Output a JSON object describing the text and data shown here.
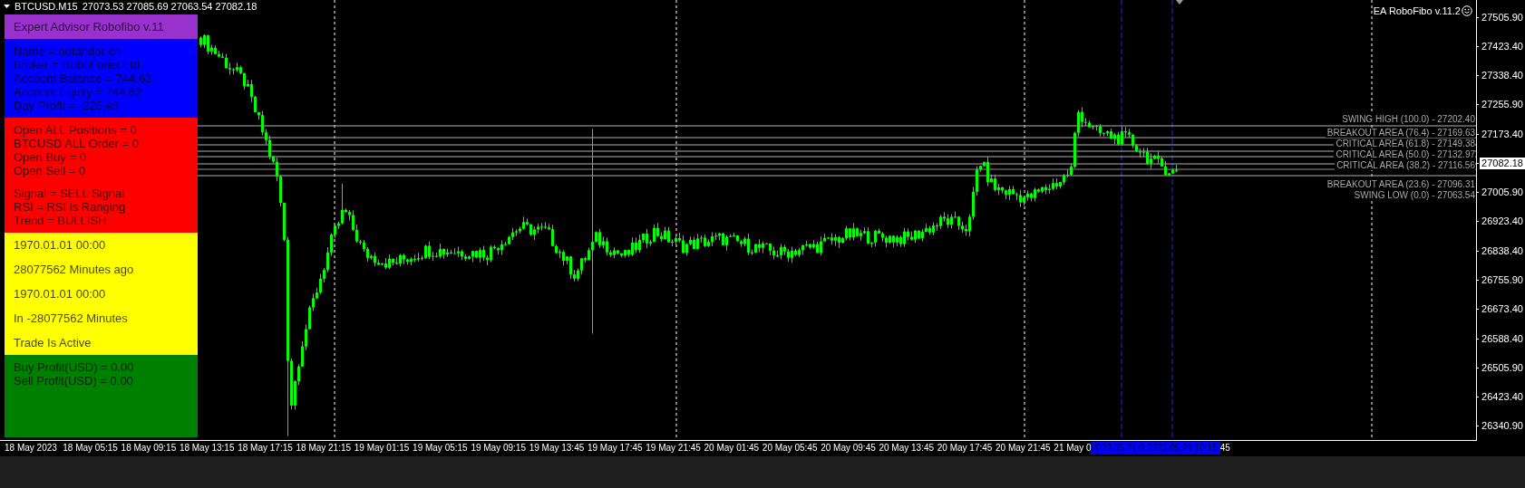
{
  "chart_header": {
    "symbol": "BTCUSD.M15",
    "quotes": "27073.53 27085.69 27063.54 27082.18"
  },
  "ea_label": "EA RoboFibo v.11.2",
  "info_panel": {
    "sections": [
      {
        "color": "#9932cc",
        "groups": [
          [
            "Expert Advisor Robofibo v.11"
          ]
        ]
      },
      {
        "color": "#0000ff",
        "groups": [
          [
            "Name = notandor cn",
            "Broker =  RoboForex Ltd",
            "Account Balance = 744.62",
            "Account Equity = 744.62",
            "Day Profit = -225.49"
          ]
        ]
      },
      {
        "color": "#ff0000",
        "groups": [
          [
            "Open ALL Positions = 0",
            "BTCUSD ALL Order = 0",
            "Open Buy  = 0",
            "Open Sell = 0"
          ],
          [
            "Signal  = SELL Signal",
            "RSI = RSI is Ranging",
            "Trend = BULLISH"
          ]
        ]
      },
      {
        "color": "#ffff00",
        "groups": [
          [
            "1970.01.01 00:00"
          ],
          [
            "28077562 Minutes ago"
          ],
          [
            "1970.01.01 00:00"
          ],
          [
            "In -28077562 Minutes"
          ],
          [
            "Trade Is Active"
          ]
        ]
      },
      {
        "color": "#008000",
        "groups": [
          [
            "Buy Profit(USD) = 0.00",
            "Sell Profit(USD) = 0.00"
          ]
        ]
      }
    ]
  },
  "fib_levels": [
    {
      "label": "SWING HIGH (100.0) - 27202.40"
    },
    {
      "label": "BREAKOUT AREA (76.4) -  27169.63"
    },
    {
      "label": "CRITICAL AREA (61.8) -  27149.38"
    },
    {
      "label": "CRITICAL AREA (50.0) -  27132.97"
    },
    {
      "label": "CRITICAL AREA (38.2) -  27116.56"
    },
    {
      "label": "BREAKOUT AREA (23.6) -  27096.31"
    },
    {
      "label": "SWING LOW (0.0) - 27063.54"
    }
  ],
  "price_axis": {
    "ticks": [
      {
        "label": "27505.90",
        "kind": "tick"
      },
      {
        "label": "27423.40",
        "kind": "tick"
      },
      {
        "label": "27338.40",
        "kind": "tick"
      },
      {
        "label": "27255.90",
        "kind": "tick"
      },
      {
        "label": "27173.40",
        "kind": "tick"
      },
      {
        "label": "27082.18",
        "kind": "current"
      },
      {
        "label": "27005.90",
        "kind": "tick"
      },
      {
        "label": "26923.40",
        "kind": "tick"
      },
      {
        "label": "26838.40",
        "kind": "tick"
      },
      {
        "label": "26755.90",
        "kind": "tick"
      },
      {
        "label": "26673.40",
        "kind": "tick"
      },
      {
        "label": "26588.40",
        "kind": "tick"
      },
      {
        "label": "26505.90",
        "kind": "tick"
      },
      {
        "label": "26423.40",
        "kind": "tick"
      },
      {
        "label": "26340.90",
        "kind": "tick"
      }
    ]
  },
  "time_axis": {
    "labels": [
      {
        "label": "18 May 2023",
        "highlighted": false
      },
      {
        "label": "18 May 05:15",
        "highlighted": false
      },
      {
        "label": "18 May 09:15",
        "highlighted": false
      },
      {
        "label": "18 May 13:15",
        "highlighted": false
      },
      {
        "label": "18 May 17:15",
        "highlighted": false
      },
      {
        "label": "18 May 21:15",
        "highlighted": false
      },
      {
        "label": "19 May 01:15",
        "highlighted": false
      },
      {
        "label": "19 May 05:15",
        "highlighted": false
      },
      {
        "label": "19 May 09:15",
        "highlighted": false
      },
      {
        "label": "19 May 13:45",
        "highlighted": false
      },
      {
        "label": "19 May 17:45",
        "highlighted": false
      },
      {
        "label": "19 May 21:45",
        "highlighted": false
      },
      {
        "label": "20 May 01:45",
        "highlighted": false
      },
      {
        "label": "20 May 05:45",
        "highlighted": false
      },
      {
        "label": "20 May 09:45",
        "highlighted": false
      },
      {
        "label": "20 May 13:45",
        "highlighted": false
      },
      {
        "label": "20 May 17:45",
        "highlighted": false
      },
      {
        "label": "20 May 21:45",
        "highlighted": false
      },
      {
        "label": "21 May 0",
        "highlighted": false
      },
      {
        "label": "2023.05.21 0",
        "highlighted": true
      },
      {
        "label": "2023.05.21 10:15",
        "highlighted": true
      },
      {
        "label": "45",
        "highlighted": false
      }
    ]
  }
}
